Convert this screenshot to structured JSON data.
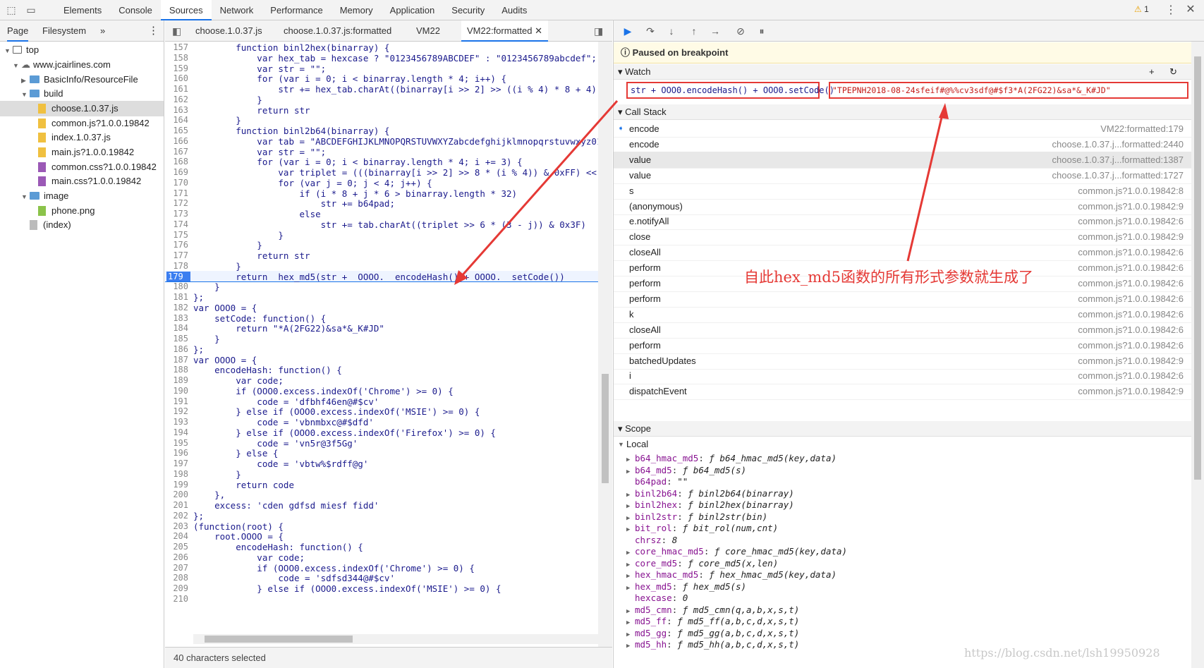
{
  "topbar": {
    "tabs": [
      "Elements",
      "Console",
      "Sources",
      "Network",
      "Performance",
      "Memory",
      "Application",
      "Security",
      "Audits"
    ],
    "active_tab": "Sources",
    "warning_count": "1"
  },
  "navigator": {
    "tabs": [
      "Page",
      "Filesystem"
    ],
    "more": "»",
    "tree": [
      {
        "label": "top"
      },
      {
        "label": "www.jcairlines.com"
      },
      {
        "label": "BasicInfo/ResourceFile"
      },
      {
        "label": "build"
      },
      {
        "label": "choose.1.0.37.js"
      },
      {
        "label": "common.js?1.0.0.19842"
      },
      {
        "label": "index.1.0.37.js"
      },
      {
        "label": "main.js?1.0.0.19842"
      },
      {
        "label": "common.css?1.0.0.19842"
      },
      {
        "label": "main.css?1.0.0.19842"
      },
      {
        "label": "image"
      },
      {
        "label": "phone.png"
      },
      {
        "label": "(index)"
      }
    ]
  },
  "editor": {
    "tabs": [
      "choose.1.0.37.js",
      "choose.1.0.37.js:formatted",
      "VM22",
      "VM22:formatted"
    ],
    "active_tab": "VM22:formatted",
    "breakpoint_line": "179",
    "lines": [
      {
        "n": "157",
        "t": "        function binl2hex(binarray) {"
      },
      {
        "n": "158",
        "t": "            var hex_tab = hexcase ? \"0123456789ABCDEF\" : \"0123456789abcdef\";"
      },
      {
        "n": "159",
        "t": "            var str = \"\";"
      },
      {
        "n": "160",
        "t": "            for (var i = 0; i < binarray.length * 4; i++) {"
      },
      {
        "n": "161",
        "t": "                str += hex_tab.charAt((binarray[i >> 2] >> ((i % 4) * 8 + 4))"
      },
      {
        "n": "162",
        "t": "            }"
      },
      {
        "n": "163",
        "t": "            return str"
      },
      {
        "n": "164",
        "t": "        }"
      },
      {
        "n": "165",
        "t": "        function binl2b64(binarray) {"
      },
      {
        "n": "166",
        "t": "            var tab = \"ABCDEFGHIJKLMNOPQRSTUVWXYZabcdefghijklmnopqrstuvwxyz01"
      },
      {
        "n": "167",
        "t": "            var str = \"\";"
      },
      {
        "n": "168",
        "t": "            for (var i = 0; i < binarray.length * 4; i += 3) {"
      },
      {
        "n": "169",
        "t": "                var triplet = (((binarray[i >> 2] >> 8 * (i % 4)) & 0xFF) <<"
      },
      {
        "n": "170",
        "t": "                for (var j = 0; j < 4; j++) {"
      },
      {
        "n": "171",
        "t": "                    if (i * 8 + j * 6 > binarray.length * 32)"
      },
      {
        "n": "172",
        "t": "                        str += b64pad;"
      },
      {
        "n": "173",
        "t": "                    else"
      },
      {
        "n": "174",
        "t": "                        str += tab.charAt((triplet >> 6 * (3 - j)) & 0x3F)"
      },
      {
        "n": "175",
        "t": "                }"
      },
      {
        "n": "176",
        "t": "            }"
      },
      {
        "n": "177",
        "t": "            return str"
      },
      {
        "n": "178",
        "t": "        }"
      },
      {
        "n": "179",
        "t": "        return  hex_md5(str +  OOOO.  encodeHash() + OOOO.  setCode())"
      },
      {
        "n": "180",
        "t": "    }"
      },
      {
        "n": "181",
        "t": "};"
      },
      {
        "n": "182",
        "t": "var OOO0 = {"
      },
      {
        "n": "183",
        "t": "    setCode: function() {"
      },
      {
        "n": "184",
        "t": "        return \"*A(2FG22)&sa*&_K#JD\""
      },
      {
        "n": "185",
        "t": "    }"
      },
      {
        "n": "186",
        "t": "};"
      },
      {
        "n": "187",
        "t": "var OOOO = {"
      },
      {
        "n": "188",
        "t": "    encodeHash: function() {"
      },
      {
        "n": "189",
        "t": "        var code;"
      },
      {
        "n": "190",
        "t": "        if (OOO0.excess.indexOf('Chrome') >= 0) {"
      },
      {
        "n": "191",
        "t": "            code = 'dfbhf46en@#$cv'"
      },
      {
        "n": "192",
        "t": "        } else if (OOO0.excess.indexOf('MSIE') >= 0) {"
      },
      {
        "n": "193",
        "t": "            code = 'vbnmbxc@#$dfd'"
      },
      {
        "n": "194",
        "t": "        } else if (OOO0.excess.indexOf('Firefox') >= 0) {"
      },
      {
        "n": "195",
        "t": "            code = 'vn5r@3f5Gg'"
      },
      {
        "n": "196",
        "t": "        } else {"
      },
      {
        "n": "197",
        "t": "            code = 'vbtw%$rdff@g'"
      },
      {
        "n": "198",
        "t": "        }"
      },
      {
        "n": "199",
        "t": "        return code"
      },
      {
        "n": "200",
        "t": "    },"
      },
      {
        "n": "201",
        "t": "    excess: 'cden gdfsd miesf fidd'"
      },
      {
        "n": "202",
        "t": "};"
      },
      {
        "n": "203",
        "t": "(function(root) {"
      },
      {
        "n": "204",
        "t": "    root.OOOO = {"
      },
      {
        "n": "205",
        "t": "        encodeHash: function() {"
      },
      {
        "n": "206",
        "t": "            var code;"
      },
      {
        "n": "207",
        "t": "            if (OOO0.excess.indexOf('Chrome') >= 0) {"
      },
      {
        "n": "208",
        "t": "                code = 'sdfsd344@#$cv'"
      },
      {
        "n": "209",
        "t": "            } else if (OOO0.excess.indexOf('MSIE') >= 0) {"
      },
      {
        "n": "210",
        "t": ""
      }
    ]
  },
  "status_text": "40 characters selected",
  "debugger": {
    "paused_text": "Paused on breakpoint",
    "watch_header": "Watch",
    "watch_expr": "str + OOO0.encodeHash() + OOO0.setCode()",
    "watch_value": "\"TPEPNH2018-08-24sfeif#@%%cv3sdf@#$f3*A(2FG22)&sa*&_K#JD\"",
    "callstack_header": "Call Stack",
    "frames": [
      {
        "name": "encode",
        "loc": "VM22:formatted:179"
      },
      {
        "name": "encode",
        "loc": "choose.1.0.37.j...formatted:2440"
      },
      {
        "name": "value",
        "loc": "choose.1.0.37.j...formatted:1387"
      },
      {
        "name": "value",
        "loc": "choose.1.0.37.j...formatted:1727"
      },
      {
        "name": "s",
        "loc": "common.js?1.0.0.19842:8"
      },
      {
        "name": "(anonymous)",
        "loc": "common.js?1.0.0.19842:9"
      },
      {
        "name": "e.notifyAll",
        "loc": "common.js?1.0.0.19842:6"
      },
      {
        "name": "close",
        "loc": "common.js?1.0.0.19842:9"
      },
      {
        "name": "closeAll",
        "loc": "common.js?1.0.0.19842:6"
      },
      {
        "name": "perform",
        "loc": "common.js?1.0.0.19842:6"
      },
      {
        "name": "perform",
        "loc": "common.js?1.0.0.19842:6"
      },
      {
        "name": "perform",
        "loc": "common.js?1.0.0.19842:6"
      },
      {
        "name": "k",
        "loc": "common.js?1.0.0.19842:6"
      },
      {
        "name": "closeAll",
        "loc": "common.js?1.0.0.19842:6"
      },
      {
        "name": "perform",
        "loc": "common.js?1.0.0.19842:6"
      },
      {
        "name": "batchedUpdates",
        "loc": "common.js?1.0.0.19842:9"
      },
      {
        "name": "i",
        "loc": "common.js?1.0.0.19842:6"
      },
      {
        "name": "dispatchEvent",
        "loc": "common.js?1.0.0.19842:9"
      }
    ],
    "scope_header": "Scope",
    "local_header": "Local",
    "scope_vars": [
      {
        "k": "b64_hmac_md5",
        "v": "ƒ b64_hmac_md5(key,data)",
        "exp": true
      },
      {
        "k": "b64_md5",
        "v": "ƒ b64_md5(s)",
        "exp": true
      },
      {
        "k": "b64pad",
        "v": "\"\"",
        "exp": false
      },
      {
        "k": "binl2b64",
        "v": "ƒ binl2b64(binarray)",
        "exp": true
      },
      {
        "k": "binl2hex",
        "v": "ƒ binl2hex(binarray)",
        "exp": true
      },
      {
        "k": "binl2str",
        "v": "ƒ binl2str(bin)",
        "exp": true
      },
      {
        "k": "bit_rol",
        "v": "ƒ bit_rol(num,cnt)",
        "exp": true
      },
      {
        "k": "chrsz",
        "v": "8",
        "exp": false
      },
      {
        "k": "core_hmac_md5",
        "v": "ƒ core_hmac_md5(key,data)",
        "exp": true
      },
      {
        "k": "core_md5",
        "v": "ƒ core_md5(x,len)",
        "exp": true
      },
      {
        "k": "hex_hmac_md5",
        "v": "ƒ hex_hmac_md5(key,data)",
        "exp": true
      },
      {
        "k": "hex_md5",
        "v": "ƒ hex_md5(s)",
        "exp": true
      },
      {
        "k": "hexcase",
        "v": "0",
        "exp": false
      },
      {
        "k": "md5_cmn",
        "v": "ƒ md5_cmn(q,a,b,x,s,t)",
        "exp": true
      },
      {
        "k": "md5_ff",
        "v": "ƒ md5_ff(a,b,c,d,x,s,t)",
        "exp": true
      },
      {
        "k": "md5_gg",
        "v": "ƒ md5_gg(a,b,c,d,x,s,t)",
        "exp": true
      },
      {
        "k": "md5_hh",
        "v": "ƒ md5_hh(a,b,c,d,x,s,t)",
        "exp": true
      }
    ]
  },
  "annotation": "自此hex_md5函数的所有形式参数就生成了",
  "watermark": "https://blog.csdn.net/lsh19950928",
  "colors": {
    "accent": "#1a73e8",
    "annotation": "#e53935",
    "paused_bg": "#fffbe6"
  }
}
